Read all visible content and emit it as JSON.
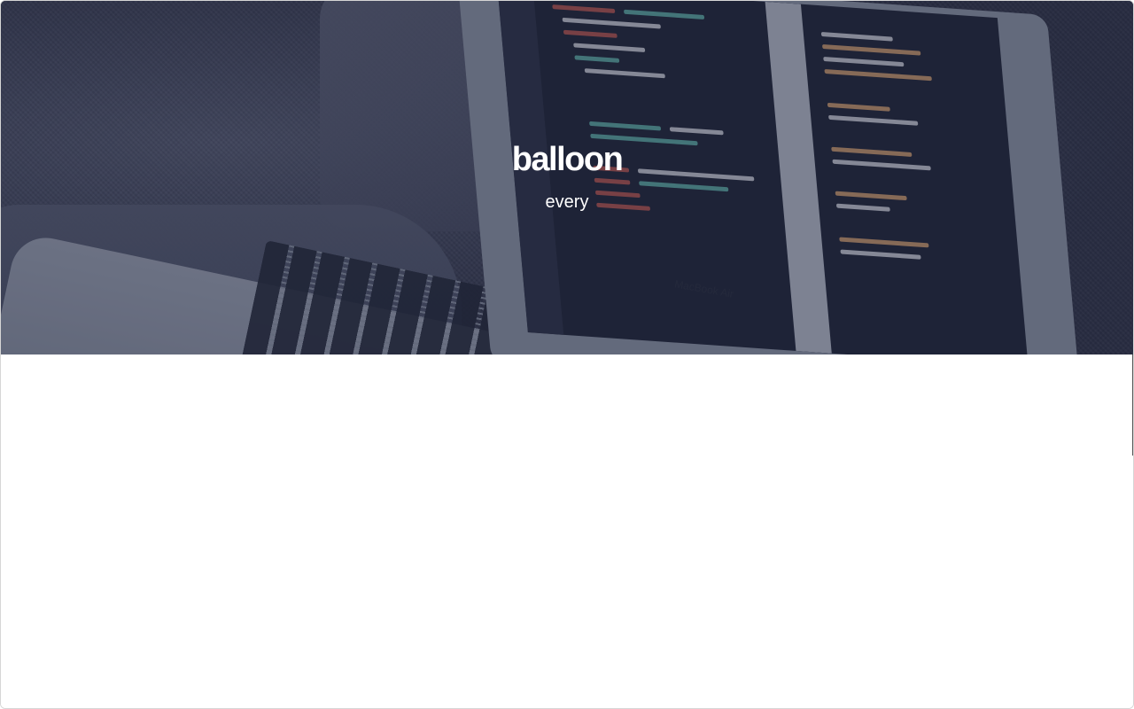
{
  "hero": {
    "title": "balloon",
    "subtitle": "every",
    "laptop_brand": "MacBook Air",
    "overlay_color": "#222840"
  },
  "colors": {
    "page_background": "#ffffff",
    "text": "#ffffff"
  }
}
